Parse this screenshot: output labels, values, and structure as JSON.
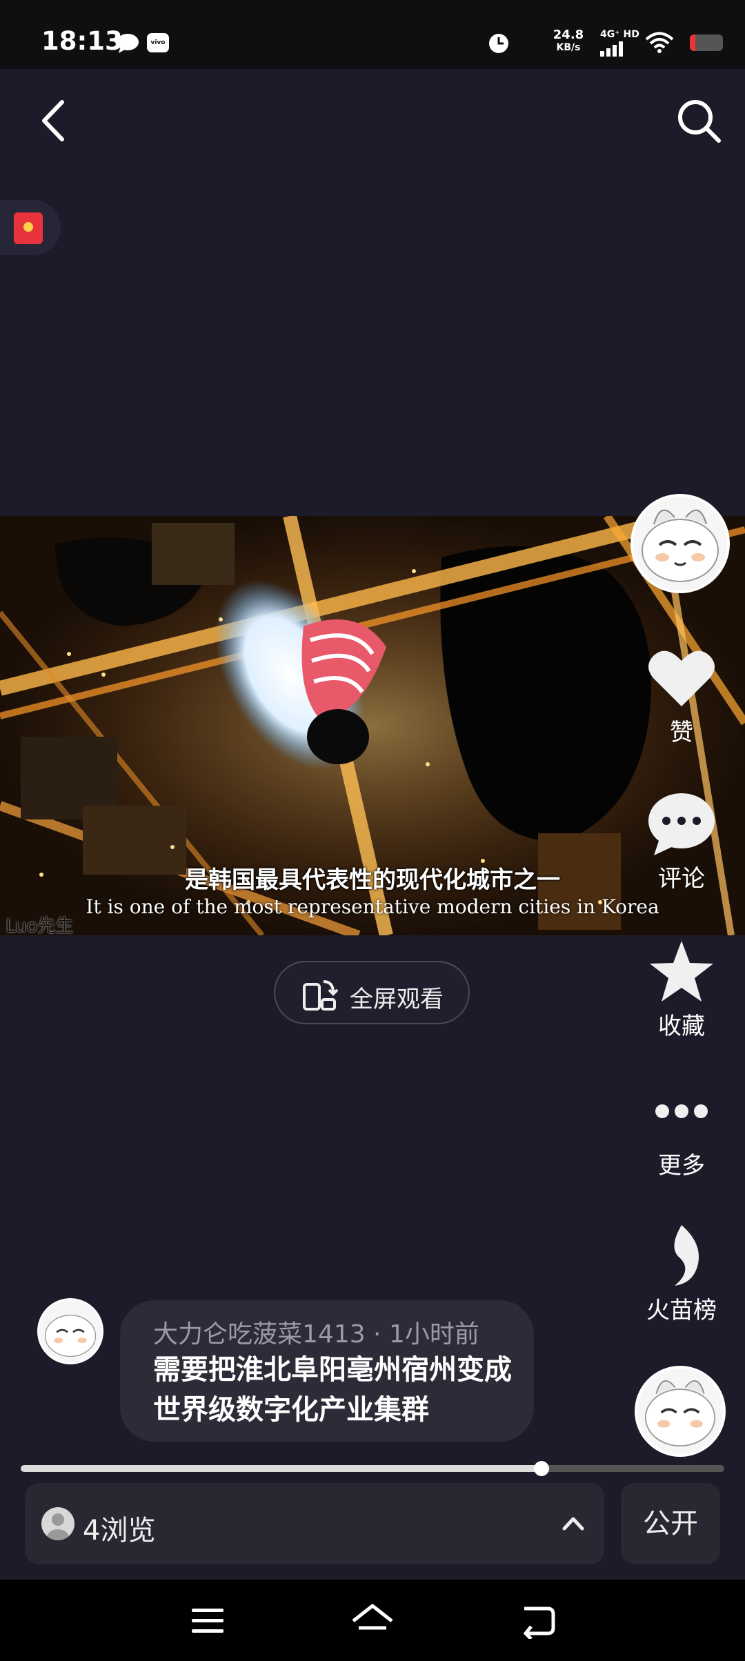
{
  "status_bar": {
    "time": "18:13",
    "speed_value": "24.8",
    "speed_unit": "KB/s",
    "network": "4G⁺ HD",
    "brand_badge": "vivo"
  },
  "video": {
    "subtitle_zh": "是韩国最具代表性的现代化城市之一",
    "subtitle_en": "It is one of the most representative modern cities in Korea",
    "watermark": "Luo先生"
  },
  "fullscreen": {
    "label": "全屏观看"
  },
  "rail": {
    "like": "赞",
    "comment": "评论",
    "favorite": "收藏",
    "more": "更多",
    "hot_rank": "火苗榜"
  },
  "comment": {
    "author_meta": "大力仑吃菠菜1413 · 1小时前",
    "text": "需要把淮北阜阳亳州宿州变成世界级数字化产业集群"
  },
  "progress": {
    "fraction": 0.74
  },
  "bottom": {
    "views": "4浏览",
    "public_label": "公开"
  },
  "colors": {
    "background": "#1b1b2a",
    "accent_red": "#e8323c"
  }
}
